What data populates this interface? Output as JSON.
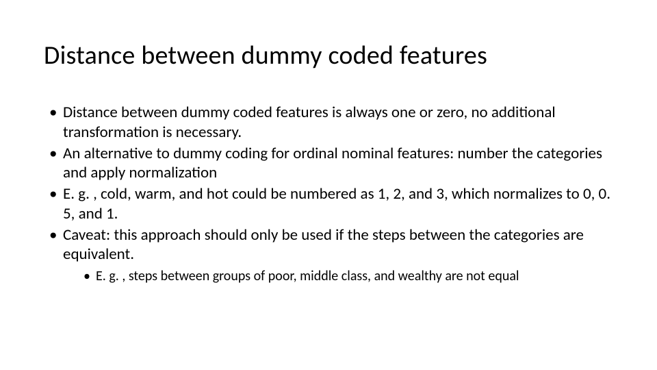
{
  "title": "Distance between dummy coded features",
  "bullets": [
    "Distance between dummy coded features is always one or zero, no additional transformation is necessary.",
    "An alternative to dummy coding for ordinal nominal features: number the categories and apply normalization",
    "E. g. , cold, warm, and hot could be numbered as 1, 2, and 3, which normalizes to 0, 0. 5, and 1.",
    "Caveat: this approach should only be used if the steps between the categories are equivalent."
  ],
  "subbullets": [
    "E. g. , steps between groups of poor, middle class, and wealthy are not equal"
  ]
}
